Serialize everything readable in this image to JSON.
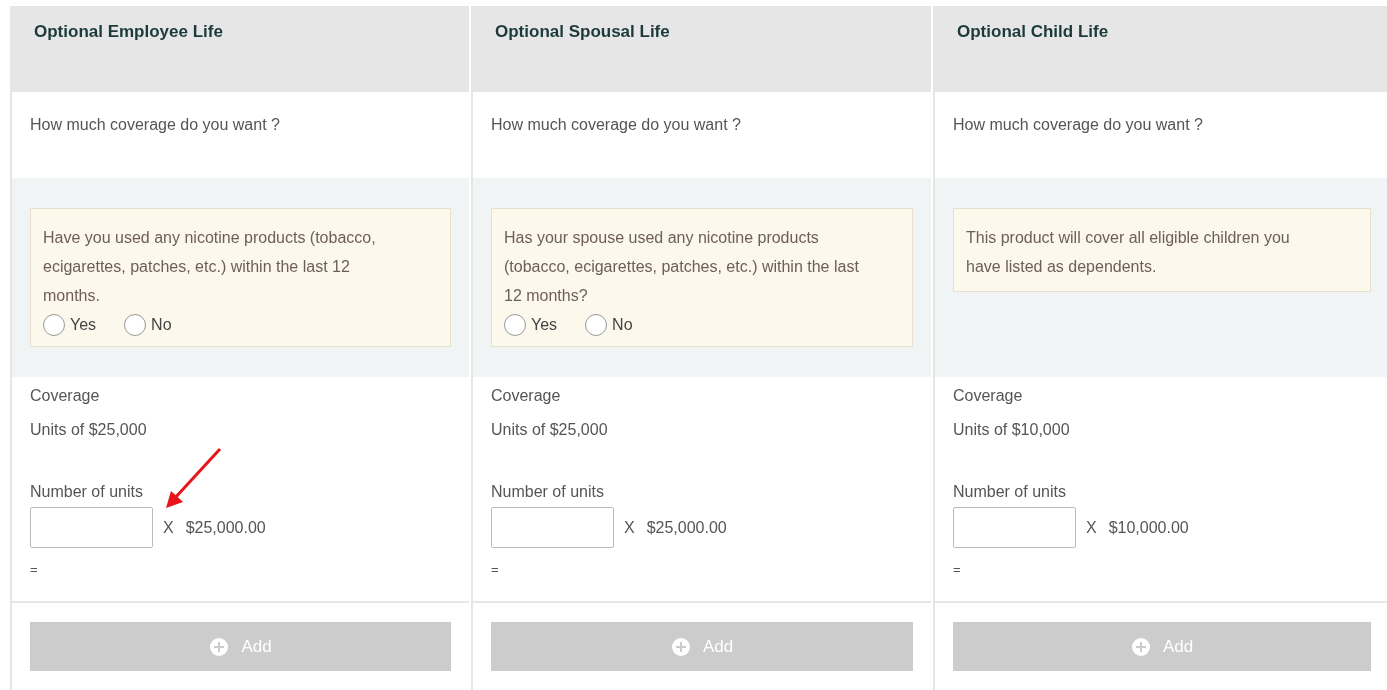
{
  "columns": [
    {
      "title": "Optional Employee Life",
      "question": "How much coverage do you want ?",
      "notice": {
        "kind": "question",
        "text": "Have you used any nicotine products (tobacco, ecigarettes, patches, etc.) within the last 12 months.",
        "options": [
          {
            "label": "Yes",
            "selected": false
          },
          {
            "label": "No",
            "selected": false
          }
        ]
      },
      "coverage_label": "Coverage",
      "units_label": "Units of $25,000",
      "number_label": "Number of units",
      "multiplier": "X",
      "amount": "$25,000.00",
      "equals": "=",
      "add_button": "Add",
      "annotated": true
    },
    {
      "title": "Optional Spousal Life",
      "question": "How much coverage do you want ?",
      "notice": {
        "kind": "question",
        "text": "Has your spouse used any nicotine products (tobacco, ecigarettes, patches, etc.) within the last 12 months?",
        "options": [
          {
            "label": "Yes",
            "selected": false
          },
          {
            "label": "No",
            "selected": false
          }
        ]
      },
      "coverage_label": "Coverage",
      "units_label": "Units of $25,000",
      "number_label": "Number of units",
      "multiplier": "X",
      "amount": "$25,000.00",
      "equals": "=",
      "add_button": "Add",
      "annotated": false
    },
    {
      "title": "Optional Child Life",
      "question": "How much coverage do you want ?",
      "notice": {
        "kind": "info",
        "text": "This product will cover all eligible children you have listed as dependents."
      },
      "coverage_label": "Coverage",
      "units_label": "Units of $10,000",
      "number_label": "Number of units",
      "multiplier": "X",
      "amount": "$10,000.00",
      "equals": "=",
      "add_button": "Add",
      "annotated": false
    }
  ]
}
